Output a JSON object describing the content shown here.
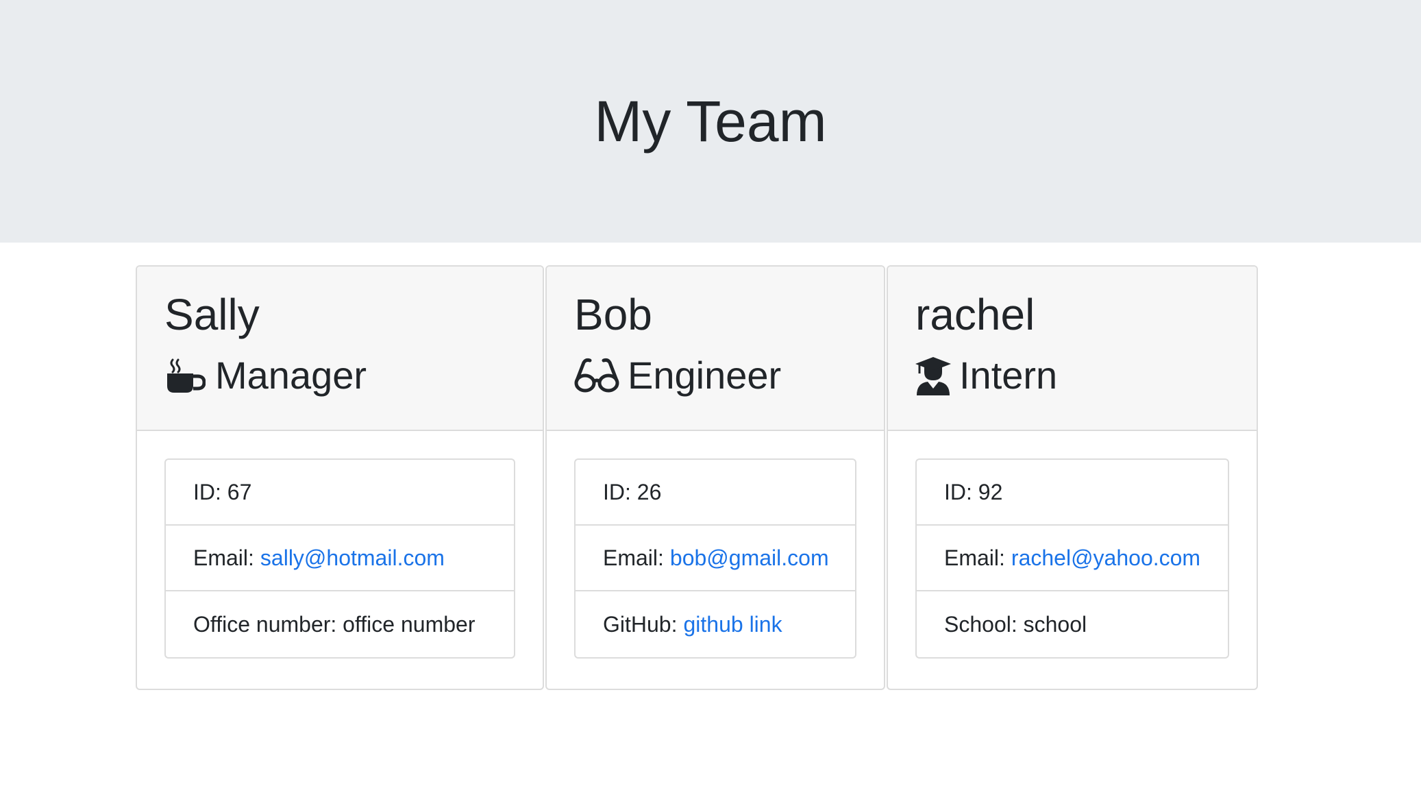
{
  "header": {
    "title": "My Team"
  },
  "employees": [
    {
      "name": "Sally",
      "role": "Manager",
      "icon": "coffee-mug-icon",
      "id_label": "ID: 67",
      "email_label": "Email:",
      "email": "sally@hotmail.com",
      "extra_label": "Office number: office number",
      "extra_link": ""
    },
    {
      "name": "Bob",
      "role": "Engineer",
      "icon": "glasses-icon",
      "id_label": "ID: 26",
      "email_label": "Email:",
      "email": "bob@gmail.com",
      "extra_label": "GitHub:",
      "extra_link": "github link"
    },
    {
      "name": "rachel",
      "role": "Intern",
      "icon": "graduate-icon",
      "id_label": "ID: 92",
      "email_label": "Email:",
      "email": "rachel@yahoo.com",
      "extra_label": "School: school",
      "extra_link": ""
    }
  ],
  "colors": {
    "jumbotron_bg": "#e9ecef",
    "link": "#1a73e8",
    "card_header_bg": "#f7f7f7"
  }
}
